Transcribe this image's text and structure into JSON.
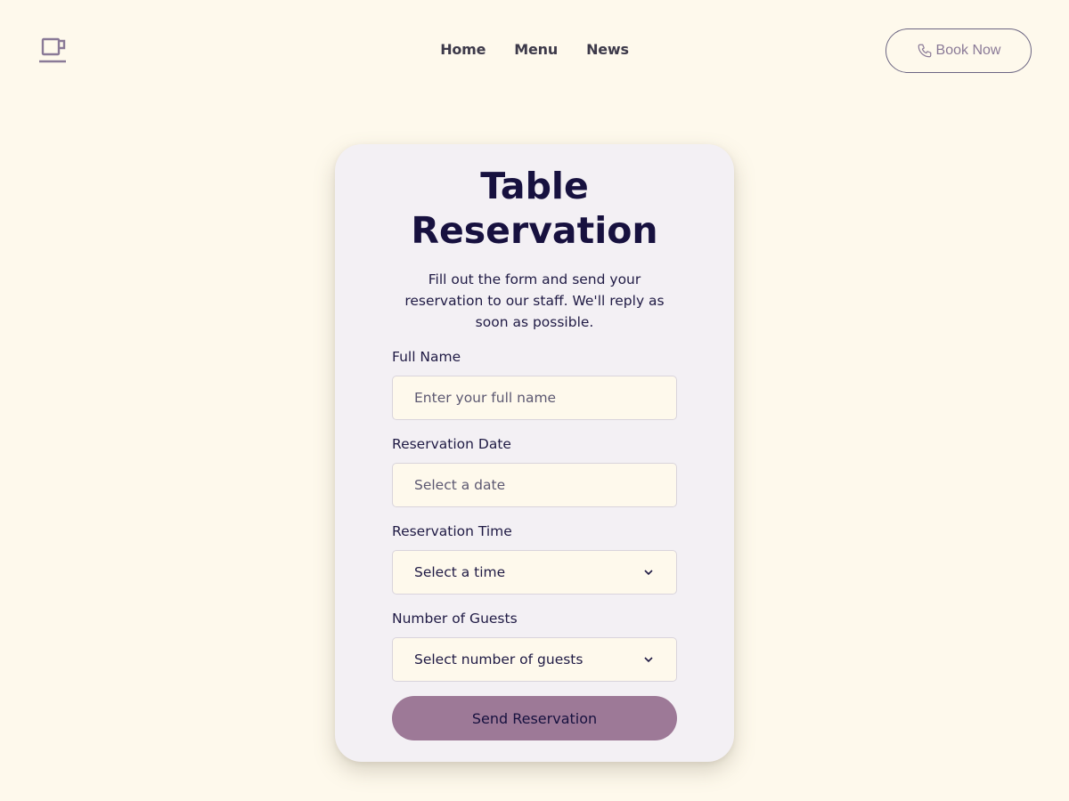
{
  "nav": {
    "logo_icon": "coffee-cup-icon",
    "links": [
      "Home",
      "Menu",
      "News"
    ],
    "book_button_label": "Book Now",
    "book_button_icon": "phone-icon"
  },
  "form": {
    "title_line1": "Table",
    "title_line2": "Reservation",
    "subtitle": "Fill out the form and send your reservation to our staff. We'll reply as soon as possible.",
    "full_name": {
      "label": "Full Name",
      "placeholder": "Enter your full name",
      "value": ""
    },
    "date": {
      "label": "Reservation Date",
      "placeholder": "Select a date",
      "value": ""
    },
    "time": {
      "label": "Reservation Time",
      "selected": "Select a time"
    },
    "guests": {
      "label": "Number of Guests",
      "selected": "Select number of guests"
    },
    "submit_label": "Send Reservation"
  },
  "colors": {
    "background": "#fef9ec",
    "card": "#f3f0f4",
    "accent": "#9d7997",
    "heading": "#17113f"
  }
}
